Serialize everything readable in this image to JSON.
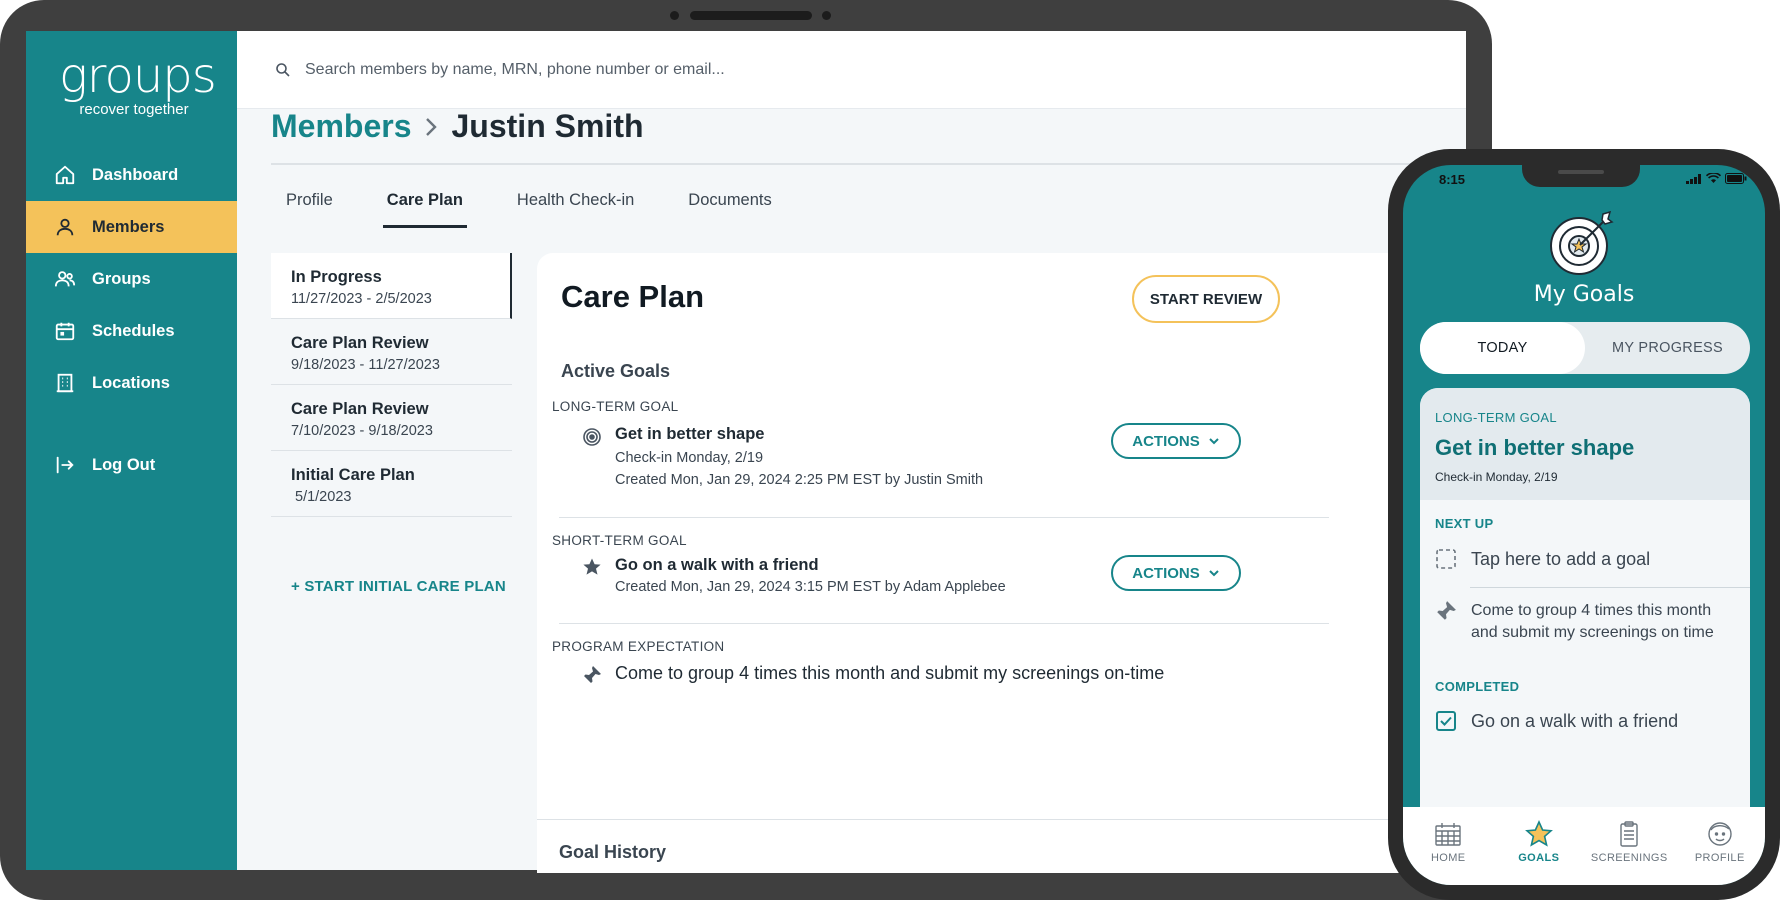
{
  "app": {
    "logo_word": "groups",
    "logo_tagline": "recover together"
  },
  "sidebar": {
    "items": [
      {
        "label": "Dashboard",
        "icon": "home-icon"
      },
      {
        "label": "Members",
        "icon": "user-icon",
        "active": true
      },
      {
        "label": "Groups",
        "icon": "users-icon"
      },
      {
        "label": "Schedules",
        "icon": "calendar-icon"
      },
      {
        "label": "Locations",
        "icon": "building-icon"
      }
    ],
    "logout_label": "Log Out"
  },
  "search": {
    "placeholder": "Search members by name, MRN, phone number or email..."
  },
  "breadcrumb": {
    "parent": "Members",
    "current": "Justin Smith"
  },
  "tabs": [
    {
      "label": "Profile"
    },
    {
      "label": "Care Plan",
      "active": true
    },
    {
      "label": "Health Check-in"
    },
    {
      "label": "Documents"
    }
  ],
  "history": [
    {
      "title": "In Progress",
      "dates": "11/27/2023 - 2/5/2023",
      "active": true
    },
    {
      "title": "Care Plan Review",
      "dates": "9/18/2023 - 11/27/2023"
    },
    {
      "title": "Care Plan Review",
      "dates": "7/10/2023 - 9/18/2023"
    },
    {
      "title": "Initial Care Plan",
      "dates": "5/1/2023"
    }
  ],
  "start_initial_label": "+ START INITIAL CARE PLAN",
  "care_plan": {
    "title": "Care Plan",
    "start_review_label": "START REVIEW",
    "active_goals_label": "Active Goals",
    "long_term": {
      "kind": "LONG-TERM GOAL",
      "title": "Get in better shape",
      "checkin": "Check-in Monday, 2/19",
      "created": "Created Mon, Jan 29, 2024 2:25 PM EST by Justin Smith",
      "actions_label": "ACTIONS"
    },
    "short_term": {
      "kind": "SHORT-TERM GOAL",
      "title": "Go on a walk with a friend",
      "created": "Created Mon, Jan 29, 2024 3:15 PM EST by Adam Applebee",
      "actions_label": "ACTIONS"
    },
    "program": {
      "kind": "PROGRAM EXPECTATION",
      "text": "Come to group 4 times this month and submit my screenings on-time"
    },
    "goal_history_label": "Goal History"
  },
  "phone": {
    "time": "8:15",
    "title": "My Goals",
    "segments": [
      {
        "label": "TODAY",
        "active": true
      },
      {
        "label": "MY PROGRESS"
      }
    ],
    "goal_kind": "LONG-TERM GOAL",
    "goal_title": "Get in better shape",
    "goal_checkin": "Check-in Monday, 2/19",
    "next_up_label": "NEXT UP",
    "add_goal_label": "Tap here to add a goal",
    "expectation_text": "Come to group 4 times this month and submit my screenings on time",
    "completed_label": "COMPLETED",
    "completed_item": "Go on a walk with a friend",
    "tabbar": [
      {
        "label": "HOME",
        "icon": "calendar-grid-icon"
      },
      {
        "label": "GOALS",
        "icon": "star-icon",
        "active": true
      },
      {
        "label": "SCREENINGS",
        "icon": "clipboard-icon"
      },
      {
        "label": "PROFILE",
        "icon": "face-icon"
      }
    ]
  },
  "colors": {
    "brand_teal": "#17858a",
    "accent_yellow": "#f4c25a",
    "frame": "#3f3f3f"
  }
}
